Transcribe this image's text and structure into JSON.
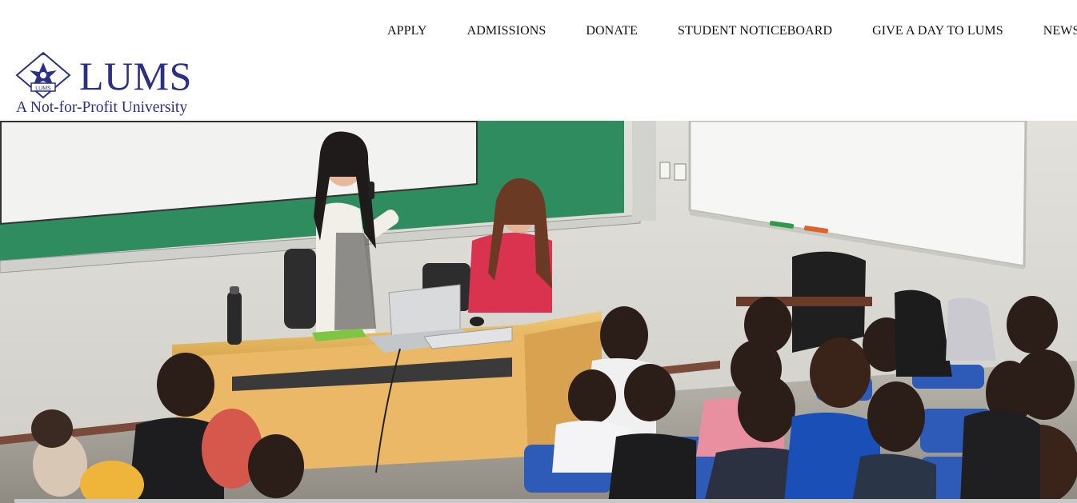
{
  "nav": {
    "apply": "APPLY",
    "admissions": "ADMISSIONS",
    "donate": "DONATE",
    "student_noticeboard": "STUDENT NOTICEBOARD",
    "give_a_day": "GIVE A DAY TO LUMS",
    "news": "NEWS"
  },
  "logo": {
    "wordmark": "LUMS",
    "tagline": "A Not-for-Profit University",
    "emblem_label": "LUMS"
  },
  "colors": {
    "brand": "#2b2f86",
    "nav_text": "#111111"
  },
  "hero": {
    "icon": "classroom-photo"
  }
}
